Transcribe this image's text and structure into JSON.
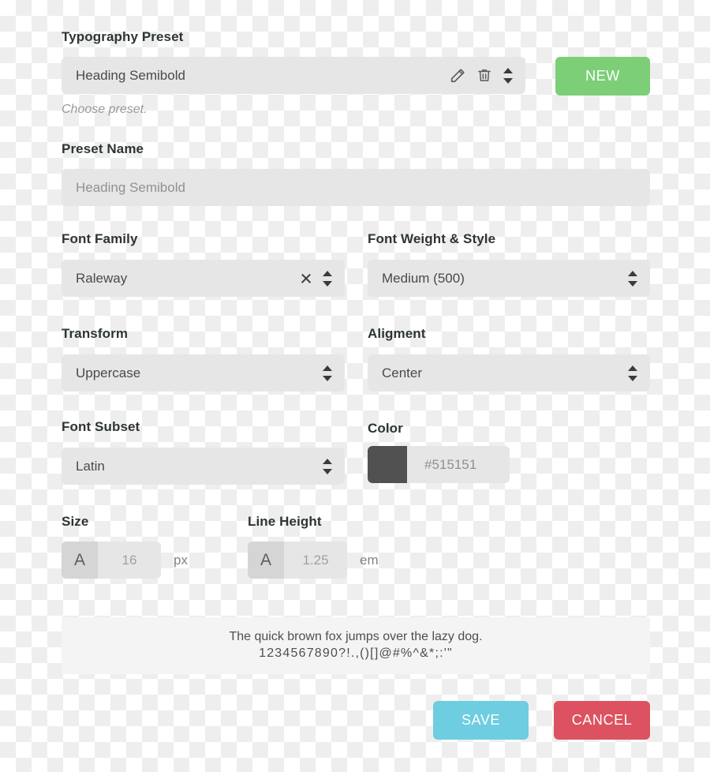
{
  "theme": {
    "new_button_color": "#7CCF77",
    "save_button_color": "#6ECDE0",
    "cancel_button_color": "#DC5260",
    "field_background": "#E6E6E6",
    "preview_background": "#F4F4F4",
    "swatch_color": "#515151"
  },
  "typography_preset": {
    "label": "Typography Preset",
    "selected": "Heading Semibold",
    "hint": "Choose preset.",
    "edit_icon": "pencil-icon",
    "delete_icon": "trash-icon",
    "spinner_icon": "updown-spinner-icon",
    "new_label": "NEW"
  },
  "preset_name": {
    "label": "Preset Name",
    "value": "Heading Semibold",
    "placeholder": "Heading Semibold"
  },
  "font_family": {
    "label": "Font Family",
    "value": "Raleway",
    "clear_icon": "close-x-icon",
    "spinner_icon": "updown-spinner-icon"
  },
  "font_weight": {
    "label": "Font Weight & Style",
    "value": "Medium (500)",
    "spinner_icon": "updown-spinner-icon"
  },
  "transform": {
    "label": "Transform",
    "value": "Uppercase",
    "spinner_icon": "updown-spinner-icon"
  },
  "aligment": {
    "label": "Aligment",
    "value": "Center",
    "spinner_icon": "updown-spinner-icon"
  },
  "font_subset": {
    "label": "Font Subset",
    "value": "Latin",
    "spinner_icon": "updown-spinner-icon"
  },
  "color": {
    "label": "Color",
    "value": "#515151",
    "placeholder": "#515151",
    "swatch": "#515151"
  },
  "size": {
    "label": "Size",
    "glyph": "A",
    "value": "16",
    "placeholder": "16",
    "unit": "px"
  },
  "line_height": {
    "label": "Line Height",
    "glyph": "A",
    "value": "1.25",
    "placeholder": "1.25",
    "unit": "em"
  },
  "preview": {
    "line1": "The quick brown fox jumps over the lazy dog.",
    "line2": "1234567890?!.,()[]@#%^&*;:'\""
  },
  "footer": {
    "save_label": "SAVE",
    "cancel_label": "CANCEL"
  }
}
